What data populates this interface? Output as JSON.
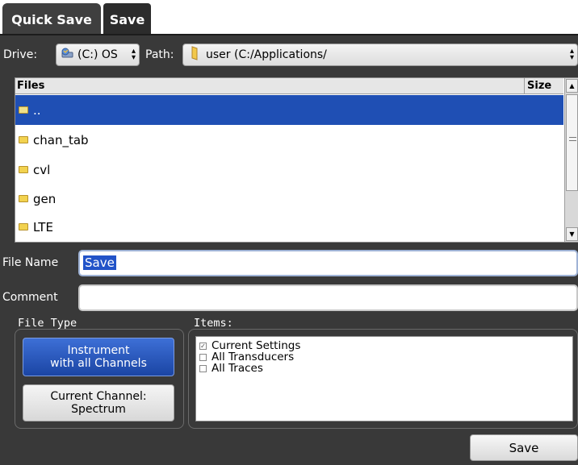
{
  "tabs": [
    {
      "label": "Quick Save",
      "active": false
    },
    {
      "label": "Save",
      "active": true
    }
  ],
  "drive": {
    "label": "Drive:",
    "value": "(C:) OS",
    "icon": "drive-icon"
  },
  "path": {
    "label": "Path:",
    "value": "user (C:/Applications/",
    "icon": "folder-icon"
  },
  "file_list": {
    "columns": [
      "Files",
      "Size"
    ],
    "rows": [
      {
        "name": "..",
        "selected": true
      },
      {
        "name": "chan_tab",
        "selected": false
      },
      {
        "name": "cvl",
        "selected": false
      },
      {
        "name": "gen",
        "selected": false
      },
      {
        "name": "LTE",
        "selected": false
      }
    ]
  },
  "file_name": {
    "label": "File Name",
    "value": "Save"
  },
  "comment": {
    "label": "Comment",
    "value": ""
  },
  "file_type": {
    "label": "File Type",
    "options": [
      {
        "line1": "Instrument",
        "line2": "with all Channels",
        "selected": true
      },
      {
        "line1": "Current Channel:",
        "line2": "Spectrum",
        "selected": false
      }
    ]
  },
  "items": {
    "label": "Items:",
    "entries": [
      {
        "label": "Current Settings",
        "checked": true
      },
      {
        "label": "All Transducers",
        "checked": false
      },
      {
        "label": "All Traces",
        "checked": false
      }
    ]
  },
  "save_button": {
    "label": "Save"
  },
  "colors": {
    "selection": "#1f4fb4",
    "panel": "#393939",
    "accent_button": "#2a58c0"
  }
}
